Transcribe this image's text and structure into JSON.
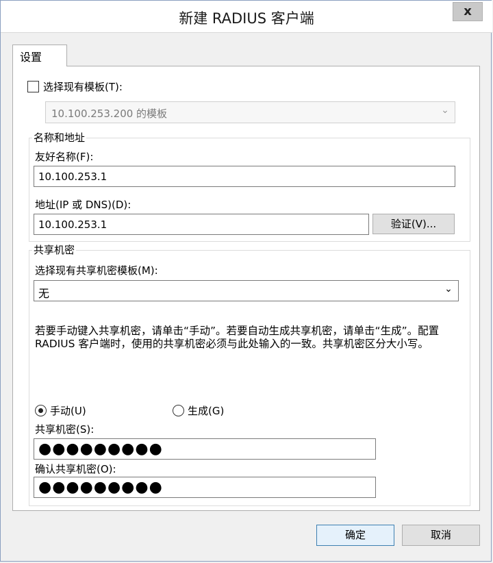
{
  "window": {
    "title": "新建 RADIUS 客户端",
    "close_label": "x"
  },
  "tabs": [
    {
      "label": "设置"
    }
  ],
  "template": {
    "checkbox_label": "选择现有模板(T):",
    "checked": false,
    "dropdown_value": "10.100.253.200 的模板"
  },
  "name_address": {
    "group_label": "名称和地址",
    "friendly_name_label": "友好名称(F):",
    "friendly_name_value": "10.100.253.1",
    "address_label": "地址(IP 或 DNS)(D):",
    "address_value": "10.100.253.1",
    "verify_button": "验证(V)..."
  },
  "shared_secret": {
    "group_label": "共享机密",
    "template_label": "选择现有共享机密模板(M):",
    "template_value": "无",
    "instructions": "若要手动键入共享机密，请单击“手动”。若要自动生成共享机密，请单击“生成”。配置 RADIUS 客户端时，使用的共享机密必须与此处输入的一致。共享机密区分大小写。",
    "radio_manual": "手动(U)",
    "radio_generate": "生成(G)",
    "selected": "manual",
    "secret_label": "共享机密(S):",
    "secret_value": "●●●●●●●●●",
    "confirm_label": "确认共享机密(O):",
    "confirm_value": "●●●●●●●●●"
  },
  "footer": {
    "ok_label": "确定",
    "cancel_label": "取消"
  }
}
